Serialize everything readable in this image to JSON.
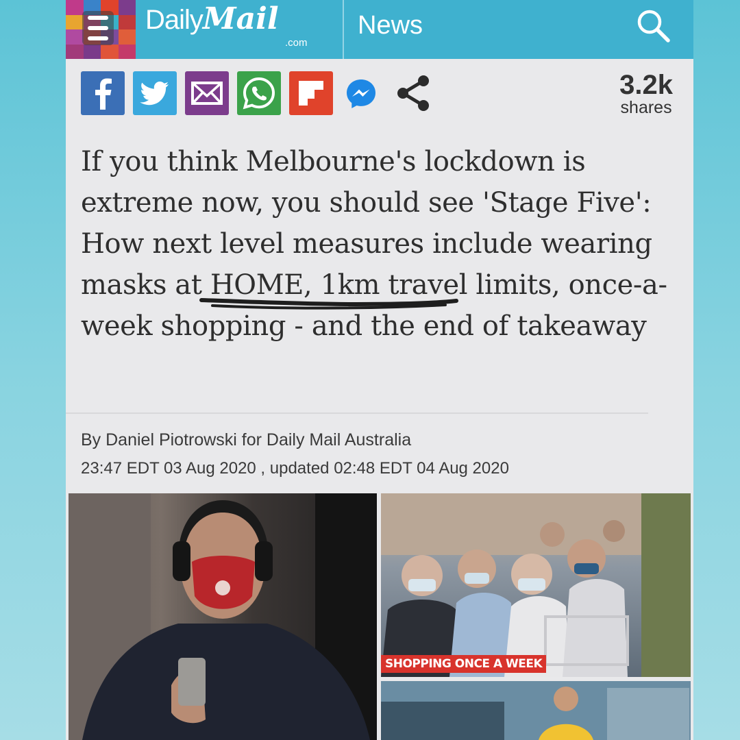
{
  "header": {
    "logo_daily": "Daily",
    "logo_mail": "Mail",
    "logo_domain": ".com",
    "section": "News"
  },
  "share_bar": {
    "buttons": [
      "facebook-icon",
      "twitter-icon",
      "email-icon",
      "whatsapp-icon",
      "flipboard-icon",
      "messenger-icon",
      "share-icon"
    ],
    "count": "3.2k",
    "count_label": "shares"
  },
  "article": {
    "headline_before": "If you think Melbourne's lockdown is extreme now, you should see 'Stage Five': How next level measures include wearing masks at HOME, 1km travel limits, once-a-week shopping - and the end of takeaway",
    "byline": "By Daniel Piotrowski for Daily Mail Australia",
    "published": "23:47 EDT 03 Aug 2020 , updated 02:48 EDT 04 Aug 2020"
  },
  "images": {
    "crowd_caption": "SHOPPING ONCE A WEEK"
  },
  "colors": {
    "header_bg": "#3fb1cf",
    "facebook": "#3b6fb6",
    "twitter": "#3aa8dd",
    "email": "#7c3c8c",
    "whatsapp": "#3ba24a",
    "flipboard": "#e0432b",
    "messenger": "#1e88e5",
    "caption_bg": "#d8332c"
  }
}
